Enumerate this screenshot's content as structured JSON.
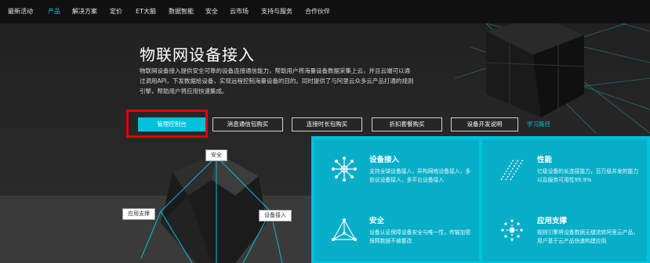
{
  "nav": {
    "items": [
      {
        "label": "最新活动"
      },
      {
        "label": "产品"
      },
      {
        "label": "解决方案"
      },
      {
        "label": "定价"
      },
      {
        "label": "ET大脑"
      },
      {
        "label": "数据智能"
      },
      {
        "label": "安全"
      },
      {
        "label": "云市场"
      },
      {
        "label": "支持与服务"
      },
      {
        "label": "合作伙伴"
      }
    ],
    "active_color": "#00c1de"
  },
  "hero": {
    "title": "物联网设备接入",
    "description": "物联网设备接入提供安全可靠的设备连接通信能力，帮助用户将海量设备数据采集上云，并且云端可以通过调用API，下发数据给设备，实现远程控制海量设备的目的。同时提供了与阿里云众多云产品打通的规则引擎，帮助用户将应用快速集成。"
  },
  "buttons": {
    "primary": "管理控制台",
    "outline": [
      "消息通信包购买",
      "连接时长包购买",
      "折扣套餐购买",
      "设备开发说明"
    ],
    "link": "学习路径"
  },
  "diagram": {
    "labels": {
      "top": "安全",
      "left": "应用支撑",
      "right": "设备接入"
    }
  },
  "features": [
    {
      "icon": "device-network-icon",
      "title": "设备接入",
      "desc": "支持全球设备接入，异构网络设备接入，多协议设备接入，多平台设备接入"
    },
    {
      "icon": "performance-icon",
      "title": "性能",
      "desc": "亿级设备的长连接能力，百万级并发的能力以及服务可用性99.9%"
    },
    {
      "icon": "security-icon",
      "title": "安全",
      "desc": "设备认证保障设备安全与唯一性，传输加密保障数据不被篡改"
    },
    {
      "icon": "app-support-icon",
      "title": "应用支撑",
      "desc": "规则引擎将设备数据无缝流转阿里云产品，用户基于云产品快速构建应用"
    }
  ],
  "colors": {
    "accent": "#00c1de",
    "panel": "#00c1de",
    "card": "#07aec8",
    "highlight": "#e10000"
  }
}
